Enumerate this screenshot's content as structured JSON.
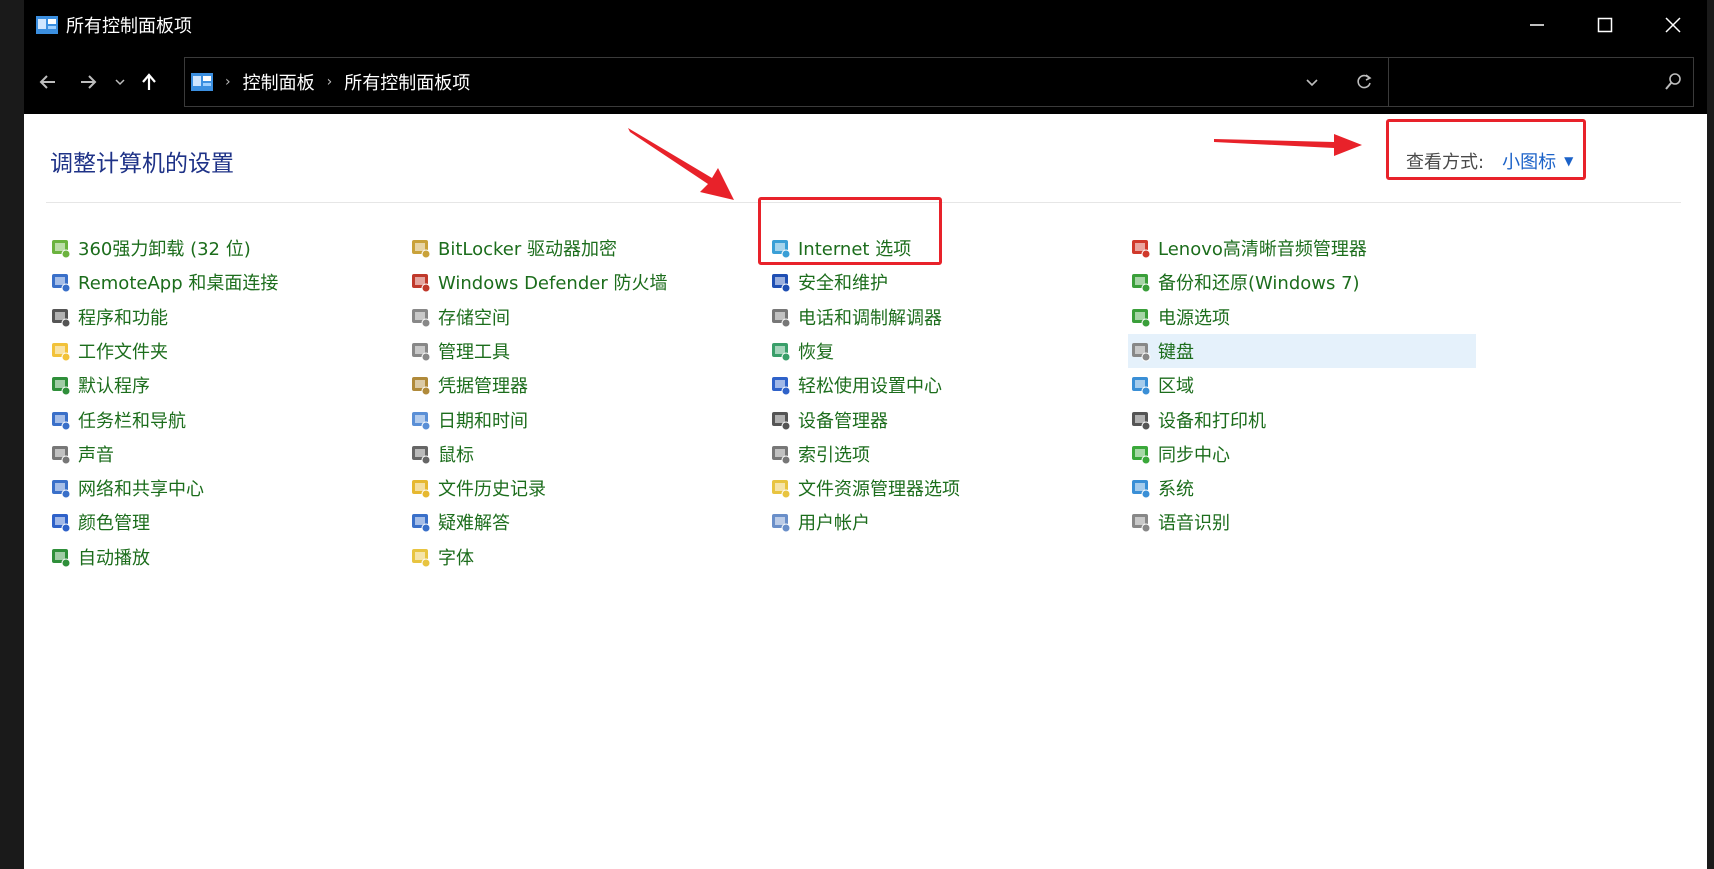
{
  "window": {
    "title": "所有控制面板项",
    "controls": [
      "minimize",
      "maximize",
      "close"
    ]
  },
  "address": {
    "crumbs": [
      "控制面板",
      "所有控制面板项"
    ],
    "search_placeholder": ""
  },
  "content": {
    "heading": "调整计算机的设置",
    "view_by_label": "查看方式:",
    "view_by_value": "小图标"
  },
  "columns": [
    [
      {
        "label": "360强力卸载 (32 位)",
        "icon": "uninstall-icon"
      },
      {
        "label": "RemoteApp 和桌面连接",
        "icon": "remoteapp-icon"
      },
      {
        "label": "程序和功能",
        "icon": "programs-icon"
      },
      {
        "label": "工作文件夹",
        "icon": "work-folders-icon"
      },
      {
        "label": "默认程序",
        "icon": "default-programs-icon"
      },
      {
        "label": "任务栏和导航",
        "icon": "taskbar-icon"
      },
      {
        "label": "声音",
        "icon": "speaker-icon"
      },
      {
        "label": "网络和共享中心",
        "icon": "network-icon"
      },
      {
        "label": "颜色管理",
        "icon": "color-management-icon"
      },
      {
        "label": "自动播放",
        "icon": "autoplay-icon"
      }
    ],
    [
      {
        "label": "BitLocker 驱动器加密",
        "icon": "bitlocker-icon"
      },
      {
        "label": "Windows Defender 防火墙",
        "icon": "firewall-icon"
      },
      {
        "label": "存储空间",
        "icon": "storage-icon"
      },
      {
        "label": "管理工具",
        "icon": "admin-tools-icon"
      },
      {
        "label": "凭据管理器",
        "icon": "credential-icon"
      },
      {
        "label": "日期和时间",
        "icon": "datetime-icon"
      },
      {
        "label": "鼠标",
        "icon": "mouse-icon"
      },
      {
        "label": "文件历史记录",
        "icon": "file-history-icon"
      },
      {
        "label": "疑难解答",
        "icon": "troubleshoot-icon"
      },
      {
        "label": "字体",
        "icon": "fonts-icon"
      }
    ],
    [
      {
        "label": "Internet 选项",
        "icon": "internet-options-icon"
      },
      {
        "label": "安全和维护",
        "icon": "flag-icon"
      },
      {
        "label": "电话和调制解调器",
        "icon": "phone-modem-icon"
      },
      {
        "label": "恢复",
        "icon": "recovery-icon"
      },
      {
        "label": "轻松使用设置中心",
        "icon": "ease-of-access-icon"
      },
      {
        "label": "设备管理器",
        "icon": "device-manager-icon"
      },
      {
        "label": "索引选项",
        "icon": "indexing-icon"
      },
      {
        "label": "文件资源管理器选项",
        "icon": "explorer-options-icon"
      },
      {
        "label": "用户帐户",
        "icon": "user-accounts-icon"
      }
    ],
    [
      {
        "label": "Lenovo高清晰音频管理器",
        "icon": "audio-manager-icon"
      },
      {
        "label": "备份和还原(Windows 7)",
        "icon": "backup-icon"
      },
      {
        "label": "电源选项",
        "icon": "power-icon"
      },
      {
        "label": "键盘",
        "icon": "keyboard-icon",
        "selected": true
      },
      {
        "label": "区域",
        "icon": "region-icon"
      },
      {
        "label": "设备和打印机",
        "icon": "printer-icon"
      },
      {
        "label": "同步中心",
        "icon": "sync-icon"
      },
      {
        "label": "系统",
        "icon": "system-icon"
      },
      {
        "label": "语音识别",
        "icon": "microphone-icon"
      }
    ]
  ],
  "colors": {
    "item_text": "#1c6d1c",
    "heading": "#1e3287",
    "link": "#1b62c8",
    "annotation": "#e8222a",
    "selection": "#e5f1fb"
  }
}
